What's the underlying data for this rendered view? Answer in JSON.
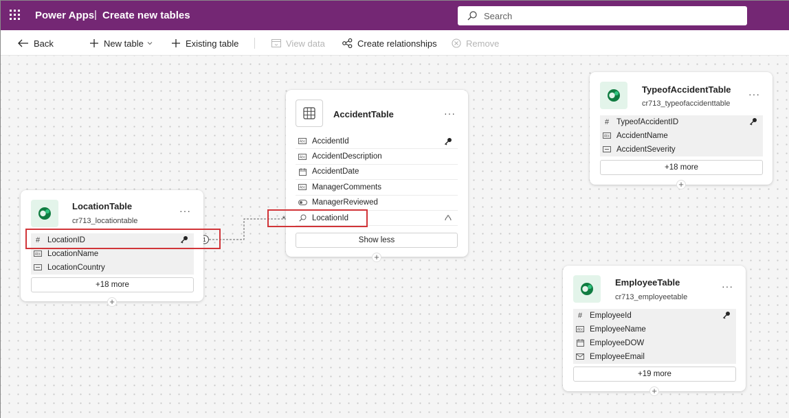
{
  "header": {
    "app_name": "Power Apps",
    "separator": "|",
    "page_title": "Create new tables",
    "search_placeholder": "Search"
  },
  "toolbar": {
    "back": "Back",
    "new_table": "New table",
    "existing_table": "Existing table",
    "view_data": "View data",
    "create_relationships": "Create relationships",
    "remove": "Remove"
  },
  "tables": {
    "location": {
      "title": "LocationTable",
      "schema": "cr713_locationtable",
      "more_menu": "···",
      "columns": [
        {
          "label": "LocationID",
          "icon": "#"
        },
        {
          "label": "LocationName",
          "icon": "text"
        },
        {
          "label": "LocationCountry",
          "icon": "choice"
        }
      ],
      "more_label": "+18 more"
    },
    "accident": {
      "title": "AccidentTable",
      "more_menu": "···",
      "columns": [
        {
          "label": "AccidentId",
          "icon": "text"
        },
        {
          "label": "AccidentDescription",
          "icon": "text"
        },
        {
          "label": "AccidentDate",
          "icon": "date"
        },
        {
          "label": "ManagerComments",
          "icon": "text"
        },
        {
          "label": "ManagerReviewed",
          "icon": "toggle"
        },
        {
          "label": "LocationId",
          "icon": "lookup"
        }
      ],
      "show_less_label": "Show less"
    },
    "type_of_accident": {
      "title": "TypeofAccidentTable",
      "schema": "cr713_typeofaccidenttable",
      "more_menu": "···",
      "columns": [
        {
          "label": "TypeofAccidentID",
          "icon": "#"
        },
        {
          "label": "AccidentName",
          "icon": "text"
        },
        {
          "label": "AccidentSeverity",
          "icon": "choice"
        }
      ],
      "more_label": "+18 more"
    },
    "employee": {
      "title": "EmployeeTable",
      "schema": "cr713_employeetable",
      "more_menu": "···",
      "columns": [
        {
          "label": "EmployeeId",
          "icon": "#"
        },
        {
          "label": "EmployeeName",
          "icon": "text"
        },
        {
          "label": "EmployeeDOW",
          "icon": "date"
        },
        {
          "label": "EmployeeEmail",
          "icon": "email"
        }
      ],
      "more_label": "+19 more"
    }
  },
  "relationship": {
    "one_label": "1",
    "many_label": "*"
  },
  "colors": {
    "brand": "#742774",
    "highlight": "#d13438",
    "dataverse": "#107c41"
  }
}
